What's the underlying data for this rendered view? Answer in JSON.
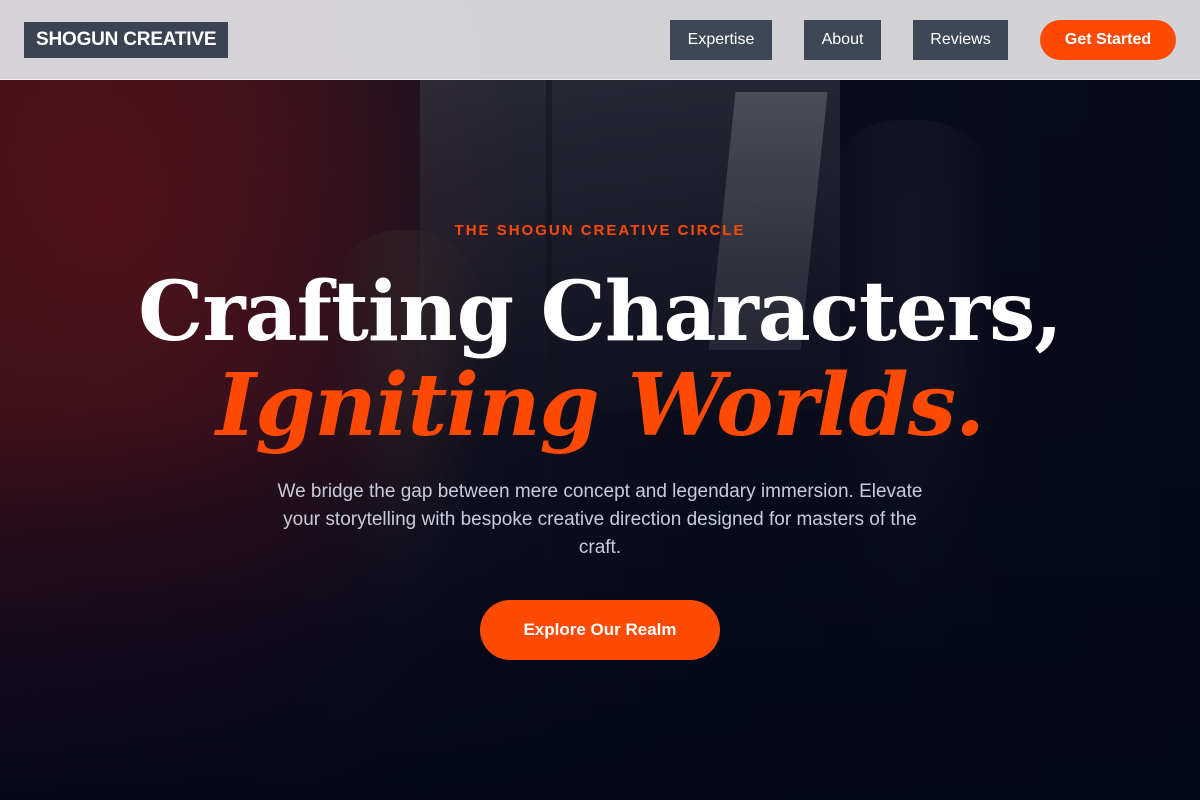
{
  "brand": {
    "logo_text": "SHOGUN CREATIVE"
  },
  "nav": {
    "items": [
      {
        "label": "Expertise"
      },
      {
        "label": "About"
      },
      {
        "label": "Reviews"
      }
    ],
    "cta_label": "Get Started"
  },
  "hero": {
    "eyebrow": "THE SHOGUN CREATIVE CIRCLE",
    "headline_line1": "Crafting Characters,",
    "headline_line2": "Igniting Worlds.",
    "subtext": "We bridge the gap between mere concept and legendary immersion. Elevate your storytelling with bespoke creative direction designed for masters of the craft.",
    "cta_label": "Explore Our Realm"
  },
  "colors": {
    "accent": "#ff4a05",
    "nav_background": "#dcdcde",
    "nav_button": "#3e4756",
    "logo_background": "#3b4252",
    "hero_background": "#05081a",
    "subtext": "#c8cbd8"
  }
}
